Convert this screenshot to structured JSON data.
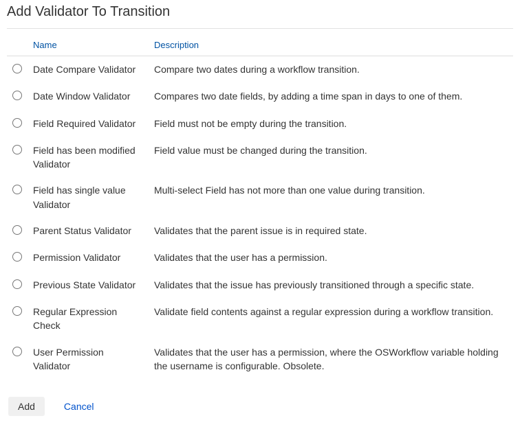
{
  "title": "Add Validator To Transition",
  "table": {
    "headers": {
      "name": "Name",
      "description": "Description"
    },
    "rows": [
      {
        "name": "Date Compare Validator",
        "description": "Compare two dates during a workflow transition."
      },
      {
        "name": "Date Window Validator",
        "description": "Compares two date fields, by adding a time span in days to one of them."
      },
      {
        "name": "Field Required Validator",
        "description": "Field must not be empty during the transition."
      },
      {
        "name": "Field has been modified Validator",
        "description": "Field value must be changed during the transition."
      },
      {
        "name": "Field has single value Validator",
        "description": "Multi-select Field has not more than one value during transition."
      },
      {
        "name": "Parent Status Validator",
        "description": "Validates that the parent issue is in required state."
      },
      {
        "name": "Permission Validator",
        "description": "Validates that the user has a permission."
      },
      {
        "name": "Previous State Validator",
        "description": "Validates that the issue has previously transitioned through a specific state."
      },
      {
        "name": "Regular Expression Check",
        "description": "Validate field contents against a regular expression during a workflow transition."
      },
      {
        "name": "User Permission Validator",
        "description": "Validates that the user has a permission, where the OSWorkflow variable holding the username is configurable. Obsolete."
      }
    ]
  },
  "footer": {
    "add": "Add",
    "cancel": "Cancel"
  }
}
